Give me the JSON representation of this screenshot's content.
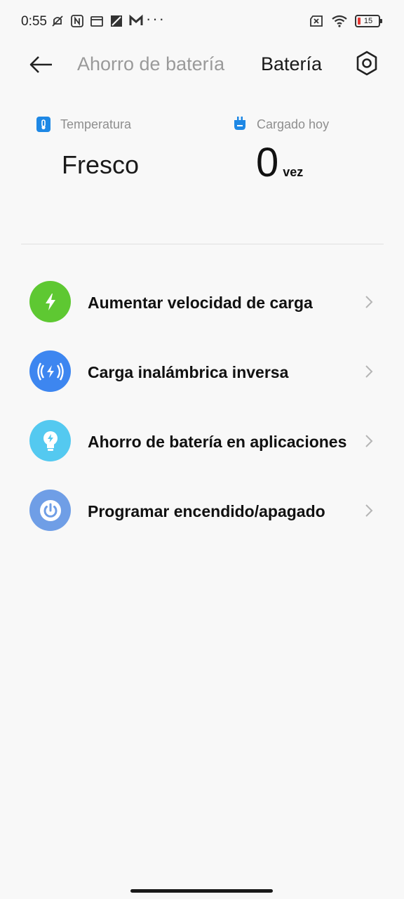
{
  "status_bar": {
    "time": "0:55",
    "dots": "···",
    "battery_level": "15",
    "battery_color": "#e53935"
  },
  "header": {
    "back_icon": "arrow-left-icon",
    "tab_battery_saver": "Ahorro de batería",
    "tab_battery": "Batería",
    "settings_icon": "settings-hexagon-icon"
  },
  "stats": {
    "temperature": {
      "label": "Temperatura",
      "value": "Fresco",
      "icon": "thermometer-icon",
      "icon_color": "#1e88e5"
    },
    "charged_today": {
      "label": "Cargado hoy",
      "value": "0",
      "unit": "vez",
      "icon": "plug-icon",
      "icon_color": "#1e88e5"
    }
  },
  "list": [
    {
      "label": "Aumentar velocidad de carga",
      "icon": "lightning-icon",
      "color": "#5ec832"
    },
    {
      "label": "Carga inalámbrica inversa",
      "icon": "wireless-charge-icon",
      "color": "#3d86f0"
    },
    {
      "label": "Ahorro de batería en aplicaciones",
      "icon": "lightbulb-icon",
      "color": "#54c9f0"
    },
    {
      "label": "Programar encendido/apagado",
      "icon": "power-icon",
      "color": "#6f9ee6"
    }
  ]
}
